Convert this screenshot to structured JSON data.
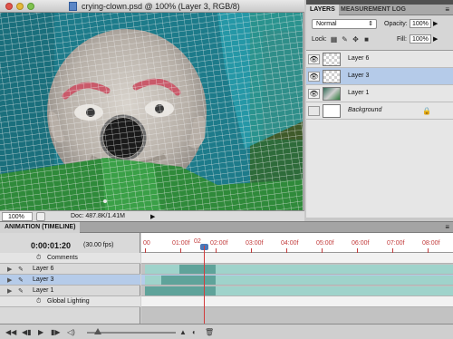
{
  "document": {
    "title": "crying-clown.psd @ 100% (Layer 3, RGB/8)",
    "zoom": "100%",
    "doc_size": "Doc: 487.8K/1.41M"
  },
  "layers_panel": {
    "tabs": [
      "LAYERS",
      "MEASUREMENT LOG"
    ],
    "blend_mode": "Normal",
    "opacity_label": "Opacity:",
    "opacity": "100%",
    "lock_label": "Lock:",
    "fill_label": "Fill:",
    "fill": "100%",
    "layers": [
      {
        "name": "Layer 6",
        "visible": true,
        "selected": false
      },
      {
        "name": "Layer 3",
        "visible": true,
        "selected": true
      },
      {
        "name": "Layer 1",
        "visible": true,
        "selected": false
      },
      {
        "name": "Background",
        "visible": false,
        "selected": false,
        "locked": true
      }
    ]
  },
  "timeline": {
    "tab": "ANIMATION (TIMELINE)",
    "timecode": "0:00:01:20",
    "fps": "(30.00 fps)",
    "ruler_labels": [
      "00",
      "01:00f",
      "02:00f",
      "03:00f",
      "04:00f",
      "05:00f",
      "06:00f",
      "07:00f",
      "08:00f"
    ],
    "current_label": "02",
    "tracks": [
      {
        "name": "Comments",
        "type": "global"
      },
      {
        "name": "Layer 6",
        "type": "layer",
        "selected": false
      },
      {
        "name": "Layer 3",
        "type": "layer",
        "selected": true
      },
      {
        "name": "Layer 1",
        "type": "layer",
        "selected": false
      },
      {
        "name": "Global Lighting",
        "type": "global"
      }
    ]
  }
}
